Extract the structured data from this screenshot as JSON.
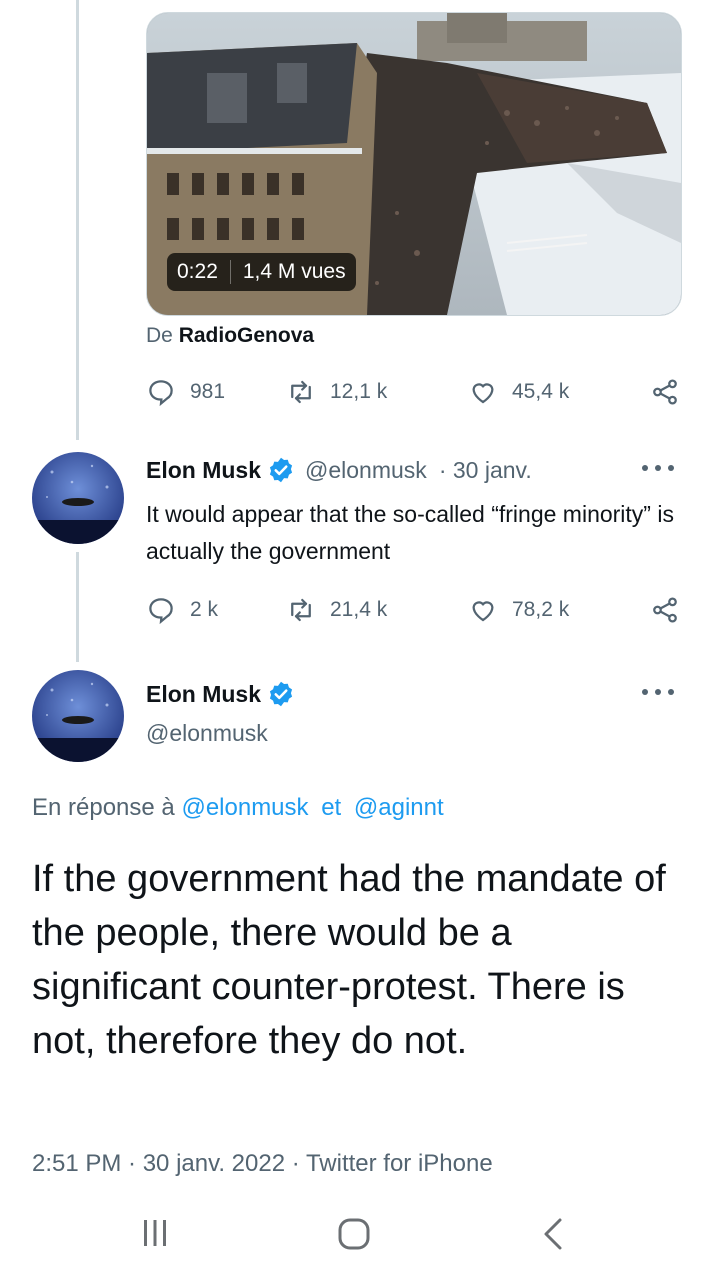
{
  "quoted_tweet": {
    "media": {
      "duration": "0:22",
      "views": "1,4 M vues"
    },
    "source_prefix": "De",
    "source_name": "RadioGenova",
    "stats": {
      "replies": "981",
      "retweets": "12,1 k",
      "likes": "45,4 k"
    }
  },
  "tweet1": {
    "author_name": "Elon Musk",
    "handle": "@elonmusk",
    "date": "· 30 janv.",
    "text": "It would appear that the so-called “fringe minority” is actually the government",
    "stats": {
      "replies": "2 k",
      "retweets": "21,4 k",
      "likes": "78,2 k"
    }
  },
  "main_tweet": {
    "author_name": "Elon Musk",
    "handle": "@elonmusk",
    "reply_prefix": "En réponse à",
    "reply_user1": "@elonmusk",
    "reply_and": "et",
    "reply_user2": "@aginnt",
    "text": "If the government had the mandate of the people, there would be a significant counter-protest. There is not, therefore they do not.",
    "timestamp": "2:51 PM · 30 janv. 2022 · Twitter for iPhone"
  },
  "colors": {
    "accent": "#1d9bf0",
    "text": "#0f1419",
    "secondary": "#536471",
    "line": "#cfd9de"
  },
  "icons": {
    "reply": "speech-bubble-icon",
    "retweet": "retweet-arrows-icon",
    "like": "heart-outline-icon",
    "share": "share-nodes-icon",
    "verified": "verified-badge-icon",
    "more": "ellipsis-icon",
    "nav_recents": "recents-bars-icon",
    "nav_home": "home-rounded-square-icon",
    "nav_back": "back-chevron-icon"
  }
}
